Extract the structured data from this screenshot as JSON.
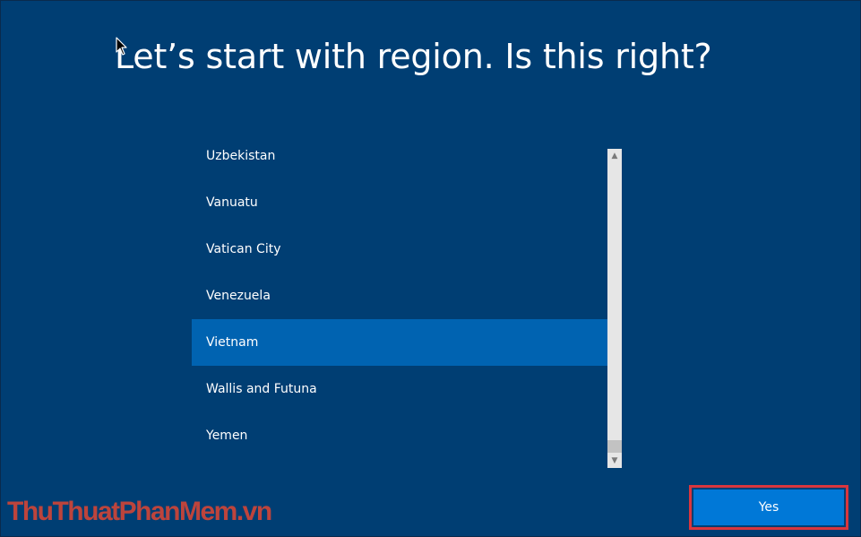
{
  "page": {
    "title": "Let’s start with region. Is this right?"
  },
  "regions": {
    "items": [
      "Uzbekistan",
      "Vanuatu",
      "Vatican City",
      "Venezuela",
      "Vietnam",
      "Wallis and Futuna",
      "Yemen"
    ],
    "selected": "Vietnam"
  },
  "actions": {
    "yes_label": "Yes"
  },
  "watermark": {
    "text": "ThuThuatPhanMem.vn"
  },
  "colors": {
    "background": "#003e73",
    "selected_item": "#0063b1",
    "button": "#0078d7",
    "highlight_border": "#d9363e",
    "watermark": "#c8453a"
  },
  "icons": {
    "cursor": "mouse-pointer-icon",
    "scroll_up": "chevron-up-icon",
    "scroll_down": "chevron-down-icon"
  }
}
